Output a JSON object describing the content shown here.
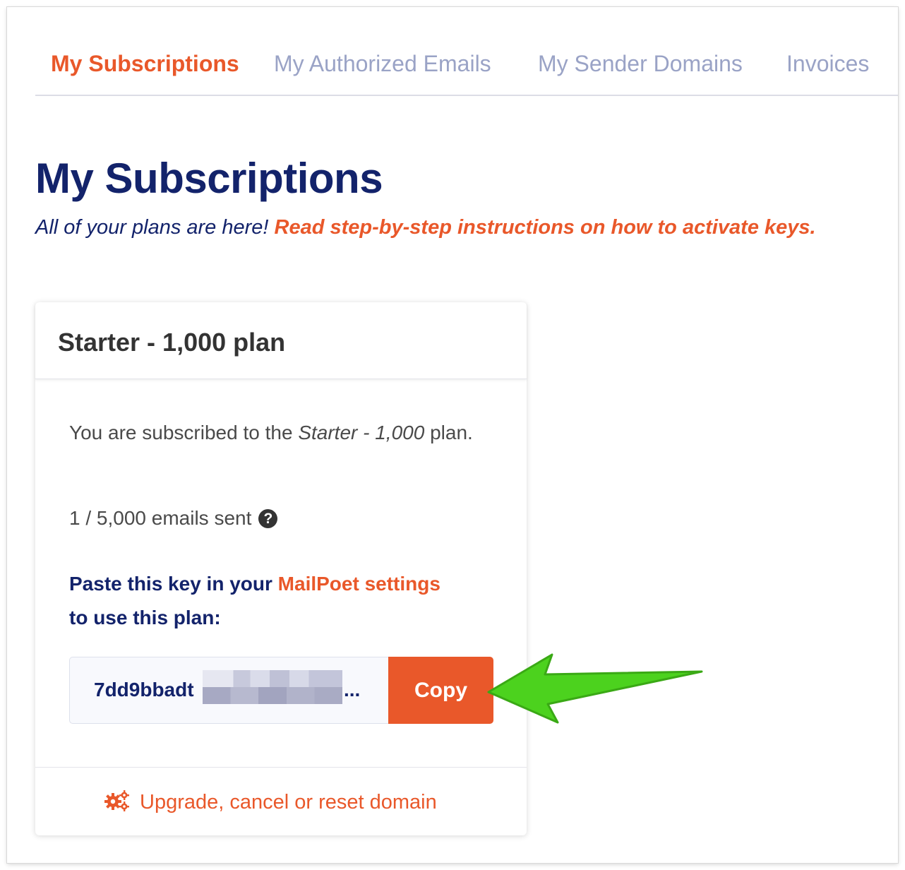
{
  "tabs": [
    {
      "label": "My Subscriptions",
      "active": true
    },
    {
      "label": "My Authorized Emails",
      "active": false
    },
    {
      "label": "My Sender Domains",
      "active": false
    },
    {
      "label": "Invoices",
      "active": false
    }
  ],
  "page": {
    "title": "My Subscriptions",
    "subtitle": "All of your plans are here!",
    "instructions_link": "Read step-by-step instructions on how to activate keys."
  },
  "plan_card": {
    "title": "Starter - 1,000 plan",
    "desc_prefix": "You are subscribed to the",
    "desc_plan": "Starter - 1,000",
    "desc_suffix": "plan.",
    "usage": "1 / 5,000 emails sent",
    "help_icon": "?",
    "paste_prefix": "Paste this key in your",
    "paste_link": "MailPoet settings",
    "paste_suffix": "to use this plan:",
    "key_visible": "7dd9bbadt",
    "key_ellipsis": "...",
    "copy_label": "Copy",
    "footer_link": "Upgrade, cancel or reset domain"
  },
  "colors": {
    "accent": "#e9582a",
    "navy": "#13236b",
    "tab_inactive": "#9aa3c6",
    "arrow": "#4cd21e"
  },
  "icons": [
    "help-icon",
    "gears-icon",
    "green-arrow-icon"
  ]
}
